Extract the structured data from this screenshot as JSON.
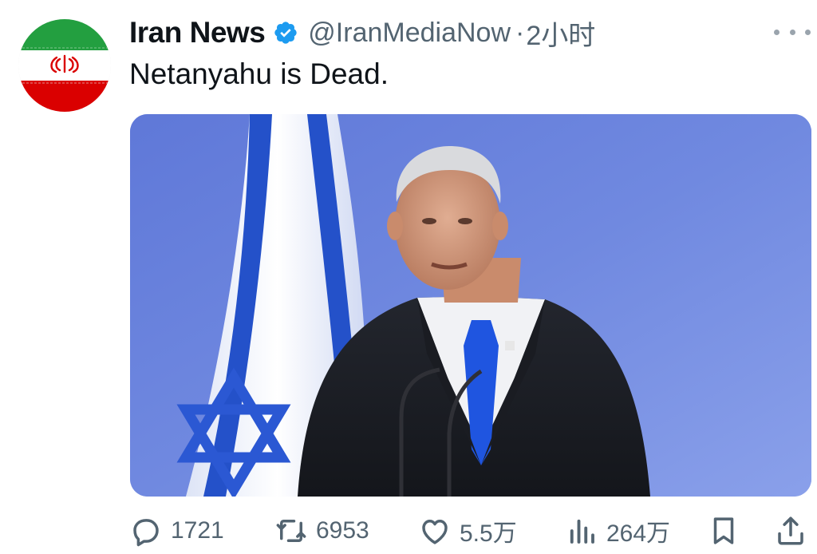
{
  "author": {
    "display_name": "Iran News",
    "handle": "@IranMediaNow",
    "separator": "·",
    "time": "2小时",
    "verified": true,
    "avatar": "iran-flag-avatar"
  },
  "tweet": {
    "text": "Netanyahu is Dead."
  },
  "media": {
    "kind": "photo",
    "subject": "speaker-at-podium-with-flag"
  },
  "actions": {
    "replies": "1721",
    "reposts": "6953",
    "likes": "5.5万",
    "views": "264万"
  },
  "colors": {
    "text": "#0f1419",
    "secondary": "#536471",
    "verified": "#1d9bf0",
    "photo_bg": "#6f86dc"
  }
}
